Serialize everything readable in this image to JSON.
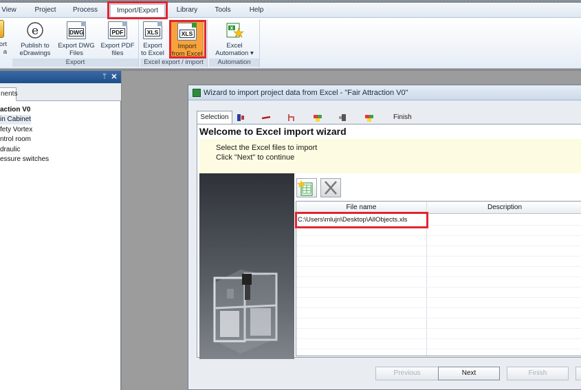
{
  "menu": {
    "items": [
      {
        "label": "View"
      },
      {
        "label": "Project"
      },
      {
        "label": "Process"
      },
      {
        "label": "Import/Export"
      },
      {
        "label": "Library"
      },
      {
        "label": "Tools"
      },
      {
        "label": "Help"
      }
    ],
    "active": "Import/Export"
  },
  "ribbon": {
    "buttons": {
      "export_data": "ort\na",
      "publish": "Publish to\neDrawings",
      "export_dwg": "Export DWG\nFiles",
      "export_pdf": "Export PDF\nfiles",
      "export_excel": "Export\nto Excel",
      "import_excel": "Import\nfrom Excel",
      "excel_automation": "Excel\nAutomation ▾"
    },
    "icon_tags": {
      "dwg": "DWG",
      "pdf": "PDF",
      "xls": "XLS"
    },
    "groups": {
      "export": "Export",
      "excel": "Excel export / import",
      "automation": "Automation"
    }
  },
  "left_panel": {
    "pin": "ᛘ",
    "close": "✕",
    "tab": "nents",
    "tree": [
      {
        "label": "action V0",
        "bold": true
      },
      {
        "label": "in Cabinet",
        "bold": false
      },
      {
        "label": "fety Vortex",
        "bold": false
      },
      {
        "label": "ntrol room",
        "bold": false
      },
      {
        "label": "draulic",
        "bold": false
      },
      {
        "label": "essure switches",
        "bold": false
      }
    ]
  },
  "wizard": {
    "title": "Wizard to import project data from Excel - \"Fair Attraction V0\"",
    "tabs": {
      "selection": "Selection",
      "finish": "Finish"
    },
    "heading": "Welcome to Excel import wizard",
    "info": [
      "Select the Excel files to import",
      "Click \"Next\" to continue"
    ],
    "grid": {
      "columns": [
        "File name",
        "Description"
      ],
      "rows": [
        {
          "file": "C:\\Users\\mlujn\\Desktop\\AllObjects.xls",
          "description": ""
        }
      ]
    },
    "buttons": {
      "previous": "Previous",
      "next": "Next",
      "finish": "Finish"
    }
  },
  "colors": {
    "highlight": "#e0262f",
    "import_button": "#f7a23d",
    "title_bar": "#1f4f8a",
    "info_background": "#fdfbe2"
  }
}
